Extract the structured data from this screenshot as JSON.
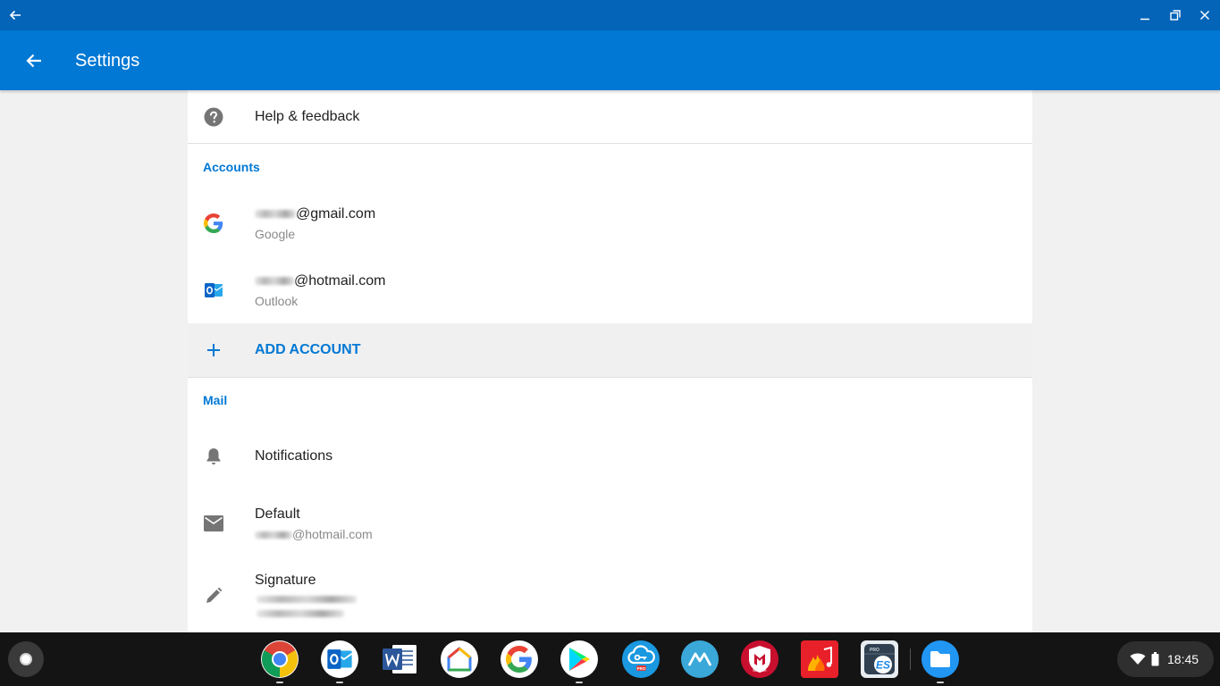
{
  "window": {
    "back_icon": "arrow-left-icon",
    "minimize_icon": "minimize-icon",
    "restore_icon": "restore-icon",
    "close_icon": "close-icon"
  },
  "appbar": {
    "title": "Settings",
    "back_icon": "arrow-left-icon",
    "color": "#0078d4"
  },
  "settings": {
    "help_feedback": "Help & feedback",
    "accounts_header": "Accounts",
    "accounts": [
      {
        "email_suffix": "@gmail.com",
        "type": "Google",
        "icon": "google-icon"
      },
      {
        "email_suffix": "@hotmail.com",
        "type": "Outlook",
        "icon": "outlook-icon"
      }
    ],
    "add_account": "ADD ACCOUNT",
    "mail_header": "Mail",
    "notifications": "Notifications",
    "default_label": "Default",
    "default_value_suffix": "@hotmail.com",
    "signature_label": "Signature"
  },
  "shelf": {
    "apps": [
      "Chrome",
      "Outlook",
      "Word",
      "Google Home",
      "Google",
      "Play Store",
      "VPN",
      "App",
      "McAfee",
      "Music",
      "ES File Explorer",
      "Files"
    ],
    "time": "18:45",
    "mcafee_label": "McAfee",
    "es_label": "ES",
    "pro_label": "PRO"
  }
}
